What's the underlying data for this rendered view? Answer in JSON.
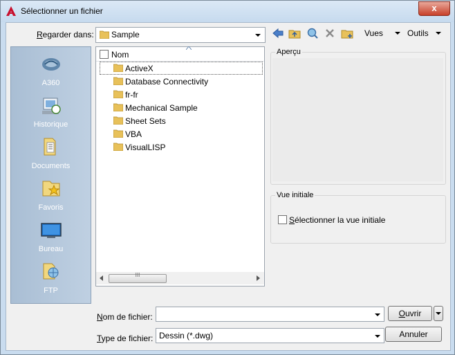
{
  "window": {
    "title": "Sélectionner un fichier",
    "close_glyph": "x"
  },
  "lookin": {
    "label_prefix": "R",
    "label_rest": "egarder dans:",
    "value": "Sample"
  },
  "toolbar": {
    "views": "Vues",
    "tools": "Outils"
  },
  "places": [
    {
      "label": "A360",
      "icon": "a360-cloud-icon"
    },
    {
      "label": "Historique",
      "icon": "history-icon"
    },
    {
      "label": "Documents",
      "icon": "documents-folder-icon"
    },
    {
      "label": "Favoris",
      "icon": "favorites-folder-icon"
    },
    {
      "label": "Bureau",
      "icon": "desktop-icon"
    },
    {
      "label": "FTP",
      "icon": "ftp-icon"
    }
  ],
  "filelist": {
    "column_header": "Nom",
    "items": [
      "ActiveX",
      "Database Connectivity",
      "fr-fr",
      "Mechanical Sample",
      "Sheet Sets",
      "VBA",
      "VisualLISP"
    ],
    "scroll_grip": "III"
  },
  "preview": {
    "title": "Aperçu"
  },
  "initial_view": {
    "title": "Vue initiale",
    "checkbox_prefix": "S",
    "checkbox_rest": "électionner la vue initiale"
  },
  "filename": {
    "label_prefix": "N",
    "label_rest": "om de fichier:",
    "value": ""
  },
  "filetype": {
    "label_prefix": "T",
    "label_rest": "ype de fichier:",
    "value": "Dessin (*.dwg)"
  },
  "buttons": {
    "open_prefix": "O",
    "open_rest": "uvrir",
    "cancel": "Annuler"
  },
  "colors": {
    "close_button": "#c7402a",
    "places_bg": "#a9bed4",
    "app_icon": "#c8102e",
    "folder": "#e8c15a"
  }
}
